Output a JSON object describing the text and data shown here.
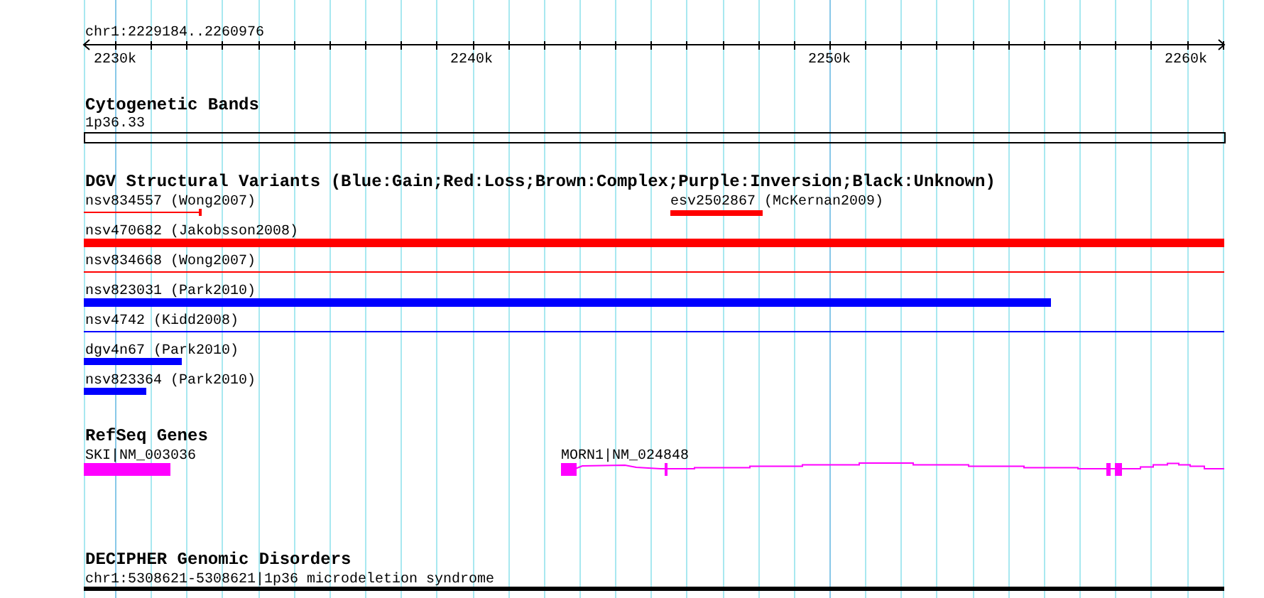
{
  "range_label": "chr1:2229184..2260976",
  "ruler": {
    "ticks": [
      "2230k",
      "2240k",
      "2250k",
      "2260k"
    ]
  },
  "tracks": [
    {
      "title": "Cytogenetic Bands",
      "features": [
        {
          "label": "1p36.33",
          "kind": "band",
          "color": "#000000"
        }
      ]
    },
    {
      "title": "DGV Structural Variants (Blue:Gain;Red:Loss;Brown:Complex;Purple:Inversion;Black:Unknown)",
      "features": [
        {
          "label": "nsv834557 (Wong2007)",
          "kind": "line",
          "color": "#ff0000"
        },
        {
          "label": "esv2502867 (McKernan2009)",
          "kind": "bar",
          "color": "#ff0000"
        },
        {
          "label": "nsv470682 (Jakobsson2008)",
          "kind": "bar",
          "color": "#ff0000"
        },
        {
          "label": "nsv834668 (Wong2007)",
          "kind": "line",
          "color": "#ff0000"
        },
        {
          "label": "nsv823031 (Park2010)",
          "kind": "bar",
          "color": "#0000ff"
        },
        {
          "label": "nsv4742 (Kidd2008)",
          "kind": "line",
          "color": "#0000ff"
        },
        {
          "label": "dgv4n67 (Park2010)",
          "kind": "bar",
          "color": "#0000ff"
        },
        {
          "label": "nsv823364 (Park2010)",
          "kind": "bar",
          "color": "#0000ff"
        }
      ]
    },
    {
      "title": "RefSeq Genes",
      "features": [
        {
          "label": "SKI|NM_003036",
          "kind": "bar",
          "color": "#ff00ff"
        },
        {
          "label": "MORN1|NM_024848",
          "kind": "gene",
          "color": "#ff00ff"
        }
      ]
    },
    {
      "title": "DECIPHER Genomic Disorders",
      "features": [
        {
          "label": "chr1:5308621-5308621|1p36 microdeletion syndrome",
          "kind": "bar",
          "color": "#000000"
        }
      ]
    }
  ]
}
